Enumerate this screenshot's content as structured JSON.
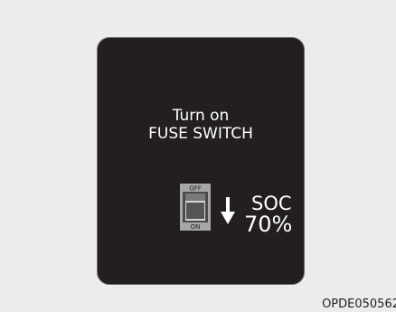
{
  "display": {
    "line1": "Turn on",
    "line2": "FUSE SWITCH"
  },
  "switch": {
    "off_label": "OFF",
    "on_label": "ON"
  },
  "soc": {
    "label": "SOC",
    "value": "70%"
  },
  "figure_code": "OPDE050562",
  "colors": {
    "screen": "#231f20",
    "page": "#ececec",
    "text": "#ffffff",
    "switch_body": "#9a9a9a"
  },
  "icons": [
    "fuse-switch-icon",
    "down-arrow-icon"
  ]
}
